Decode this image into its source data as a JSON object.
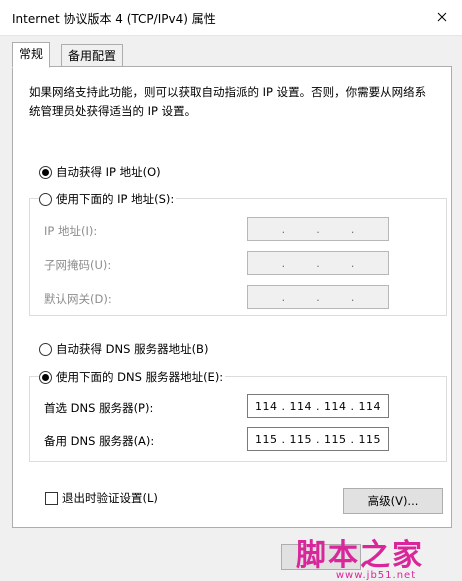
{
  "window": {
    "title": "Internet 协议版本 4 (TCP/IPv4) 属性"
  },
  "tabs": [
    {
      "label": "常规",
      "active": true
    },
    {
      "label": "备用配置",
      "active": false
    }
  ],
  "description": "如果网络支持此功能，则可以获取自动指派的 IP 设置。否则，你需要从网络系统管理员处获得适当的 IP 设置。",
  "ip": {
    "auto_label": "自动获得 IP 地址(O)",
    "auto_selected": true,
    "manual_label": "使用下面的 IP 地址(S):",
    "manual_selected": false,
    "fields": [
      {
        "label": "IP 地址(I):",
        "octets": [
          "",
          "",
          "",
          ""
        ]
      },
      {
        "label": "子网掩码(U):",
        "octets": [
          "",
          "",
          "",
          ""
        ]
      },
      {
        "label": "默认网关(D):",
        "octets": [
          "",
          "",
          "",
          ""
        ]
      }
    ]
  },
  "dns": {
    "auto_label": "自动获得 DNS 服务器地址(B)",
    "auto_selected": false,
    "manual_label": "使用下面的 DNS 服务器地址(E):",
    "manual_selected": true,
    "preferred_label": "首选 DNS 服务器(P):",
    "preferred_value": "114 . 114 . 114 . 114",
    "alternate_label": "备用 DNS 服务器(A):",
    "alternate_value": "115 . 115 . 115 . 115"
  },
  "validate_label": "退出时验证设置(L)",
  "validate_checked": false,
  "advanced_button": "高级(V)...",
  "watermark": {
    "text": "脚本之家",
    "url": "www.jb51.net"
  },
  "colors": {
    "watermark": "#d9269a",
    "window_bg": "#f0f0f0",
    "panel_bg": "#ffffff"
  }
}
